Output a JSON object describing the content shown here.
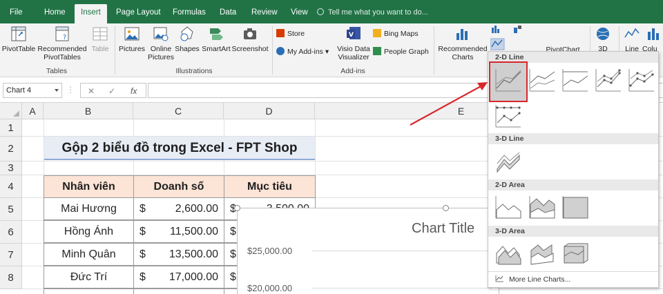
{
  "tabs": [
    "File",
    "Home",
    "Insert",
    "Page Layout",
    "Formulas",
    "Data",
    "Review",
    "View"
  ],
  "tell_me": "Tell me what you want to do...",
  "ribbon": {
    "pivot_table": "PivotTable",
    "recommended_pivot_1": "Recommended",
    "recommended_pivot_2": "PivotTables",
    "table": "Table",
    "group_tables": "Tables",
    "pictures": "Pictures",
    "online_pictures_1": "Online",
    "online_pictures_2": "Pictures",
    "shapes": "Shapes",
    "smartart": "SmartArt",
    "screenshot": "Screenshot",
    "group_illustrations": "Illustrations",
    "store": "Store",
    "my_addins": "My Add-ins",
    "visio_1": "Visio Data",
    "visio_2": "Visualizer",
    "bing_maps": "Bing Maps",
    "people_graph": "People Graph",
    "group_addins": "Add-ins",
    "recommended_charts_1": "Recommended",
    "recommended_charts_2": "Charts",
    "pivotchart": "PivotChart",
    "3d": "3D",
    "line": "Line",
    "column": "Colu"
  },
  "formula_bar": {
    "name_box": "Chart 4",
    "fx": "fx"
  },
  "columns": [
    "A",
    "B",
    "C",
    "D",
    "E"
  ],
  "rows": [
    "1",
    "2",
    "3",
    "4",
    "5",
    "6",
    "7",
    "8"
  ],
  "sheet_title": "Gộp 2 biểu đồ trong Excel - FPT Shop",
  "table": {
    "headers": [
      "Nhân viên",
      "Doanh số",
      "Mục tiêu"
    ],
    "currency": "$",
    "rows": [
      {
        "name": "Mai Hương",
        "sales": "2,600.00",
        "target": "3,500.00"
      },
      {
        "name": "Hồng Ánh",
        "sales": "11,500.00",
        "target": ""
      },
      {
        "name": "Minh Quân",
        "sales": "13,500.00",
        "target": ""
      },
      {
        "name": "Đức Trí",
        "sales": "17,000.00",
        "target": ""
      }
    ]
  },
  "chart": {
    "title": "Chart Title",
    "y_labels": [
      "$25,000.00",
      "$20,000.00"
    ]
  },
  "dropdown": {
    "sections": [
      "2-D Line",
      "3-D Line",
      "2-D Area",
      "3-D Area"
    ],
    "more": "More Line Charts..."
  },
  "colors": {
    "excel_green": "#217346",
    "header_fill": "#fce4d6",
    "highlight_red": "#d8262a"
  }
}
